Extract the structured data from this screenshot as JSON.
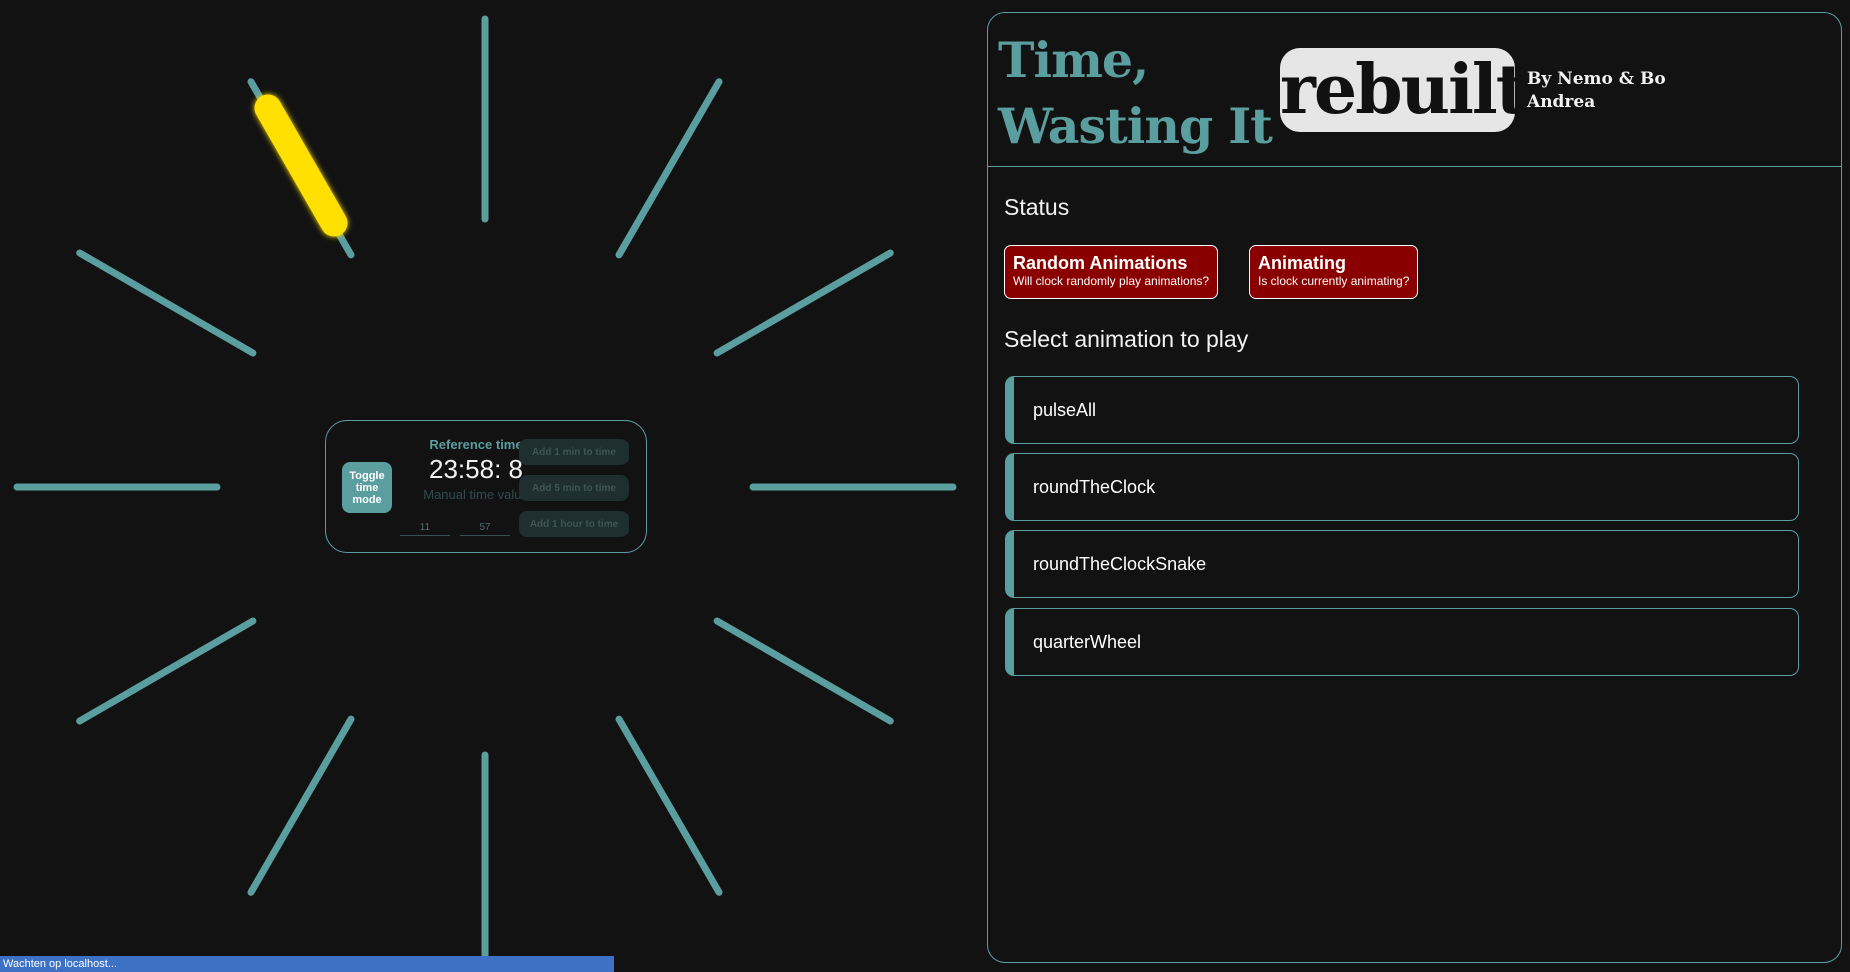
{
  "clock": {
    "hand_color": "#5a9ea0",
    "highlight_color": "#ffe000",
    "center": {
      "toggle_label": "Toggle time mode",
      "reference_label": "Reference time",
      "time_value": "23:58: 8",
      "manual_label": "Manual time value",
      "hour_input": "11",
      "minute_input": "57",
      "add_1_min_label": "Add 1 min to time",
      "add_5_min_label": "Add 5 min to time",
      "add_1_hour_label": "Add 1 hour to time"
    }
  },
  "browser_status": "Wachten op localhost...",
  "header": {
    "title": "Time, Wasting It",
    "badge": "rebuilt",
    "by_line": "By Nemo & Bo Andrea"
  },
  "status": {
    "heading": "Status",
    "items": [
      {
        "title": "Random Animations",
        "subtitle": "Will clock randomly play animations?",
        "color": "#8a0000"
      },
      {
        "title": "Animating",
        "subtitle": "Is clock currently animating?",
        "color": "#8a0000"
      }
    ]
  },
  "animations": {
    "heading": "Select animation to play",
    "items": [
      "pulseAll",
      "roundTheClock",
      "roundTheClockSnake",
      "quarterWheel"
    ]
  }
}
